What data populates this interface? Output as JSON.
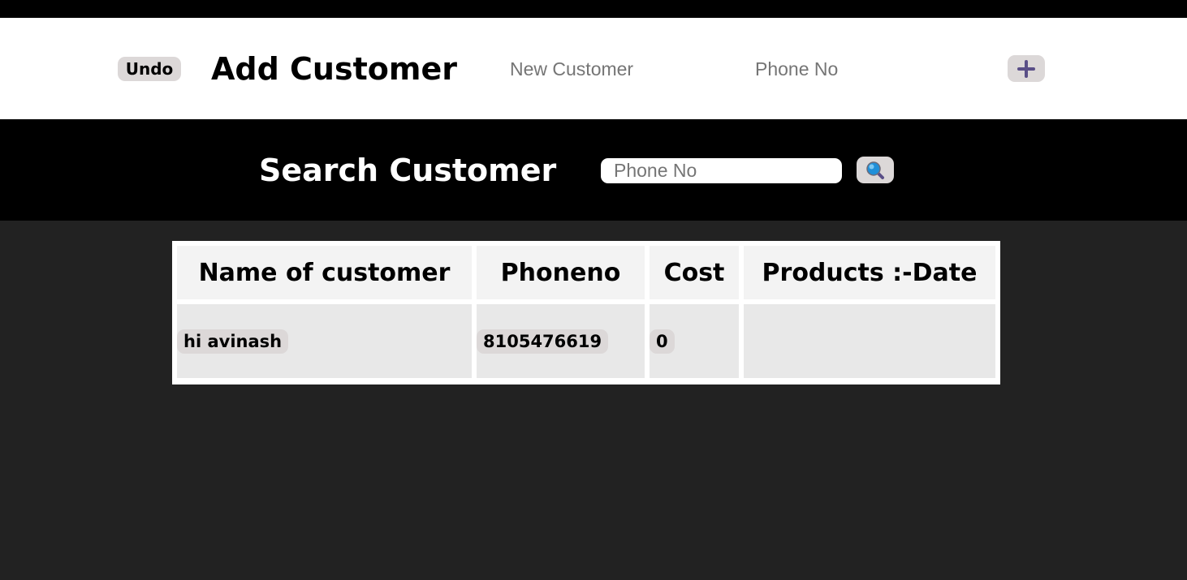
{
  "add_customer": {
    "undo_label": "Undo",
    "title": "Add Customer",
    "name_placeholder": "New Customer",
    "phone_placeholder": "Phone No",
    "add_icon": "plus-icon"
  },
  "search_customer": {
    "title": "Search Customer",
    "phone_placeholder": "Phone No",
    "search_icon": "search-icon"
  },
  "table": {
    "headers": [
      "Name of customer",
      "Phoneno",
      "Cost",
      "Products :-Date"
    ],
    "rows": [
      {
        "name": "hi avinash",
        "phone": "8105476619",
        "cost": "0",
        "products": ""
      }
    ]
  },
  "colors": {
    "page_background": "#222222",
    "add_section_background": "#ffffff",
    "search_section_background": "#000000",
    "button_background": "#dcd8d8",
    "plus_icon_color": "#5a4f87",
    "table_header_background": "#f3f3f3",
    "table_cell_background": "#e8e8e8"
  }
}
